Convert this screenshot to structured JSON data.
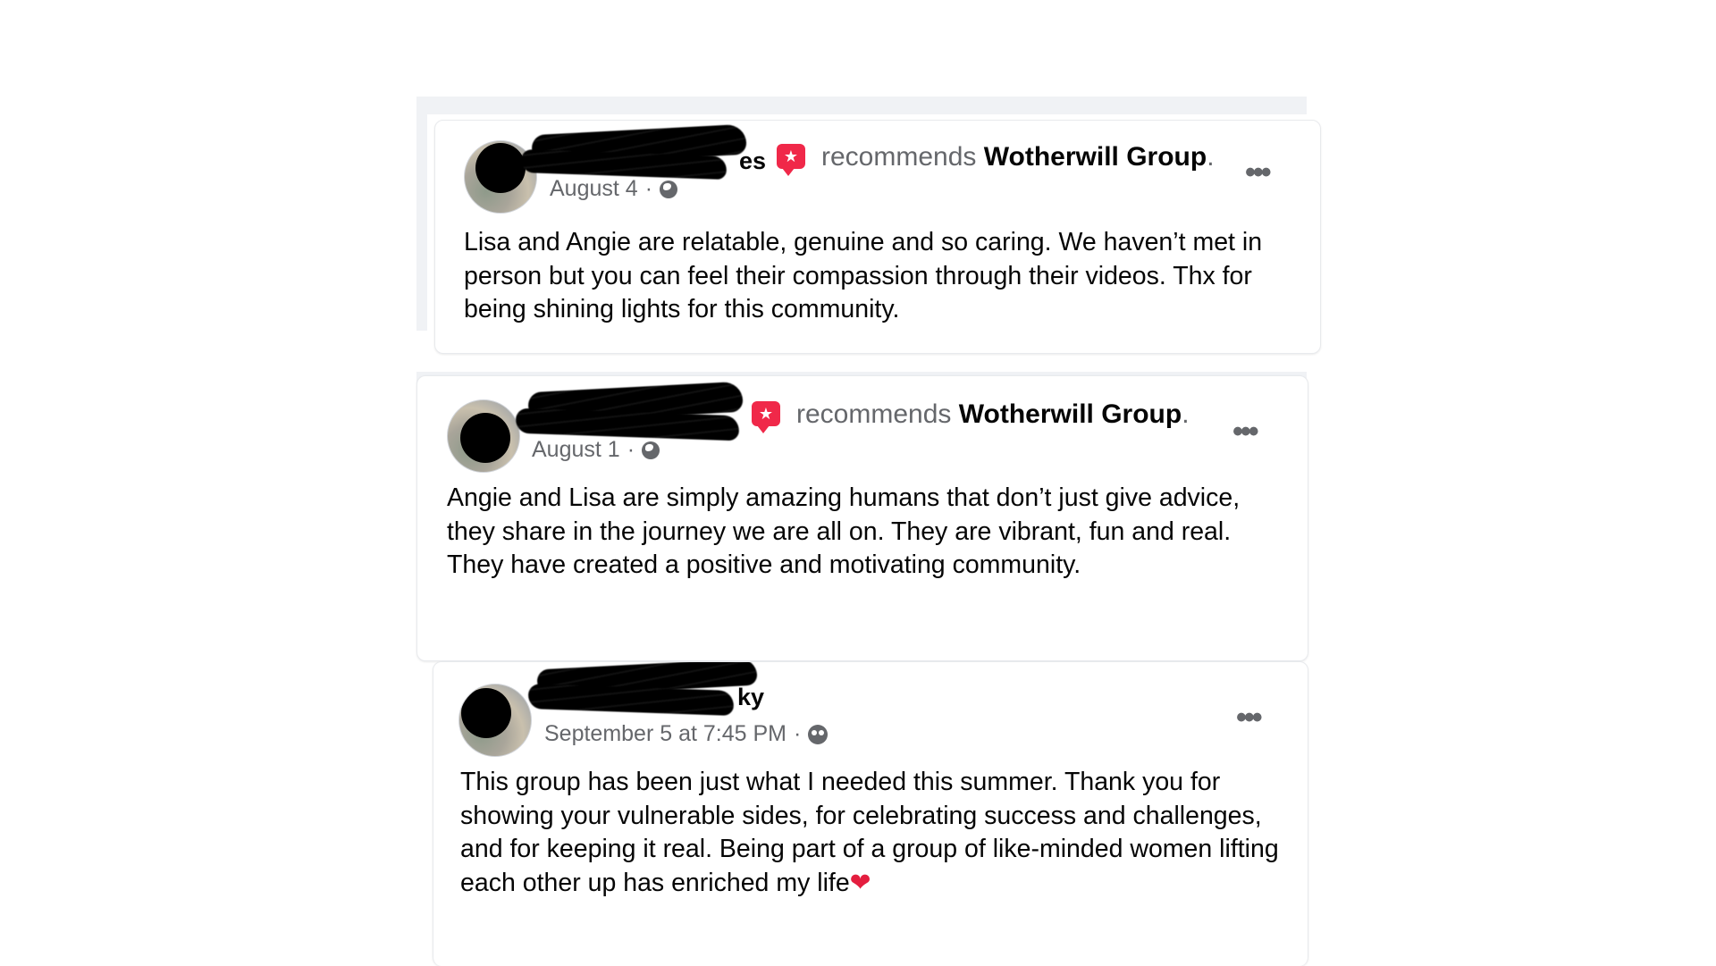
{
  "posts": [
    {
      "name_visible": "es",
      "verb": "recommends",
      "group": "Wotherwill Group",
      "date": "August 4",
      "audience_icon": "globe-icon",
      "text": "Lisa and Angie are relatable, genuine and so caring. We haven’t met in person but you can feel their compassion through their videos. Thx for being shining lights for this community."
    },
    {
      "name_visible": "",
      "verb": "recommends",
      "group": "Wotherwill Group",
      "date": "August 1",
      "audience_icon": "globe-icon",
      "text": "Angie and Lisa are simply amazing humans that don’t just give advice, they share in the journey we are all on. They are vibrant, fun and real. They have created a positive and motivating community."
    },
    {
      "name_visible": "ky",
      "date": "September 5 at 7:45 PM",
      "audience_icon": "friends-icon",
      "text": "This group has been just what I needed this summer. Thank you for showing your vulnerable sides, for celebrating success and challenges, and for keeping it real. Being part of a group of like-minded women lifting each other up has enriched my life",
      "emoji": "❤"
    }
  ],
  "ui": {
    "separator": "·",
    "period": ".",
    "more_label": "•••",
    "badge_icon": "★"
  },
  "colors": {
    "secondary_text": "#65676b",
    "badge": "#f02849",
    "heart": "#e41e3f"
  }
}
